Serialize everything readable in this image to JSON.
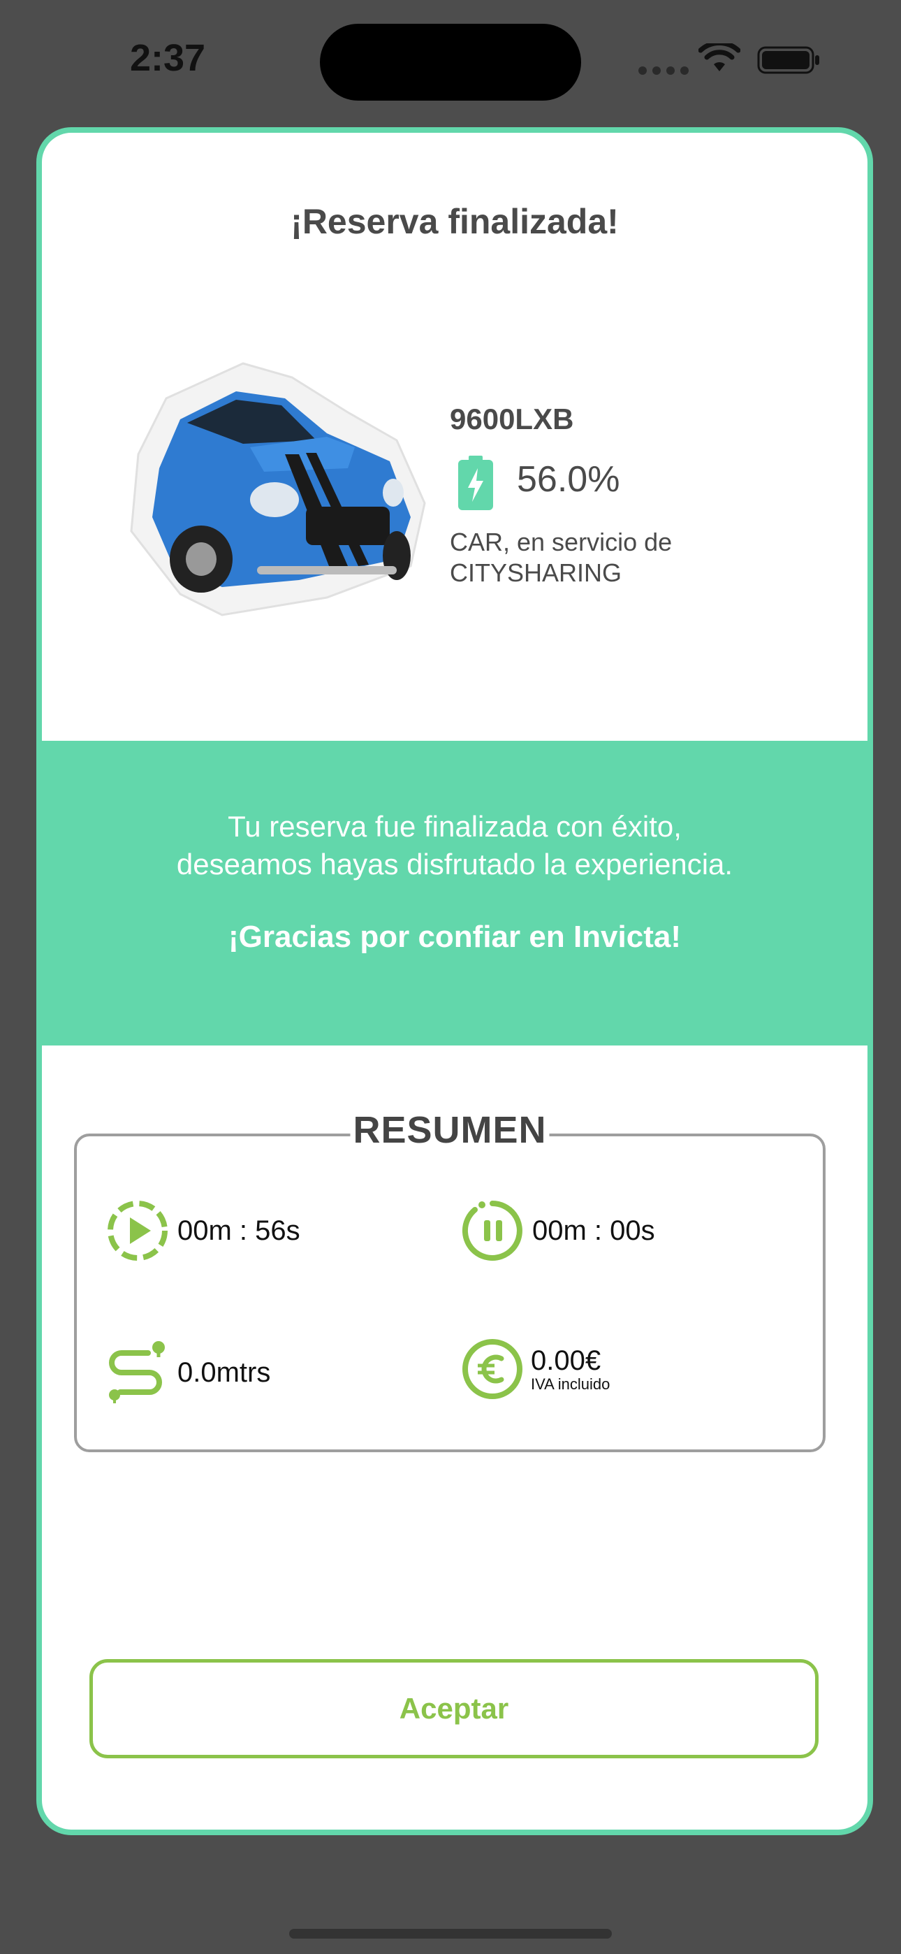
{
  "status_bar": {
    "time": "2:37"
  },
  "card": {
    "title": "¡Reserva finalizada!",
    "vehicle": {
      "plate": "9600LXB",
      "battery": "56.0%",
      "type_line1": "CAR, en servicio de",
      "type_line2": "CITYSHARING"
    },
    "banner": {
      "message": "Tu reserva fue finalizada con éxito, deseamos hayas disfrutado la experiencia.",
      "thanks": "¡Gracias por confiar en Invicta!"
    },
    "summary": {
      "title": "RESUMEN",
      "drive_time": "00m : 56s",
      "pause_time": "00m : 00s",
      "distance": "0.0mtrs",
      "price": "0.00€",
      "price_note": "IVA incluido"
    },
    "accept_label": "Aceptar"
  },
  "colors": {
    "accent": "#62d7ab",
    "green": "#8bc34a",
    "background": "#4d4d4d"
  },
  "icons": [
    "wifi-icon",
    "battery-status-icon",
    "car-image",
    "battery-charge-icon",
    "play-timer-icon",
    "pause-timer-icon",
    "route-icon",
    "euro-icon"
  ]
}
